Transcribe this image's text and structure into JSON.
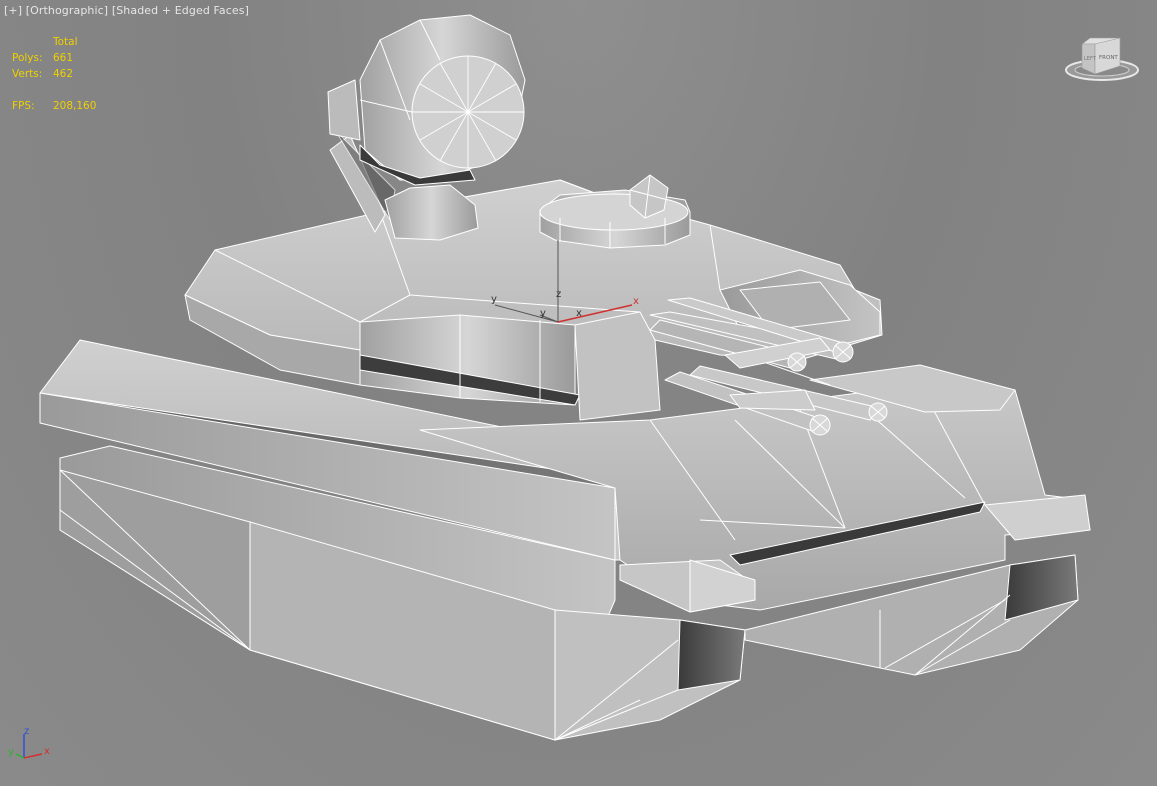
{
  "viewport": {
    "label_plus": "[+]",
    "label_view": "[Orthographic]",
    "label_shading": "[Shaded + Edged Faces]"
  },
  "stats": {
    "header": "Total",
    "polys_label": "Polys:",
    "polys_value": "661",
    "verts_label": "Verts:",
    "verts_value": "462",
    "fps_label": "FPS:",
    "fps_value": "208,160"
  },
  "viewcube": {
    "face_left": "LEFT",
    "face_front": "FRONT",
    "icon": "viewcube-icon"
  },
  "gizmo": {
    "x": "x",
    "y": "y",
    "z": "z",
    "y2": "y"
  },
  "axis_tripod": {
    "x": "x",
    "y": "y",
    "z": "z"
  },
  "colors": {
    "background": "#868686",
    "stats_text": "#f0d000",
    "label_text": "#e6e6e6",
    "wire": "#ffffff",
    "axis_x": "#d23030",
    "axis_y": "#2fb02f",
    "axis_z": "#3050d8"
  }
}
